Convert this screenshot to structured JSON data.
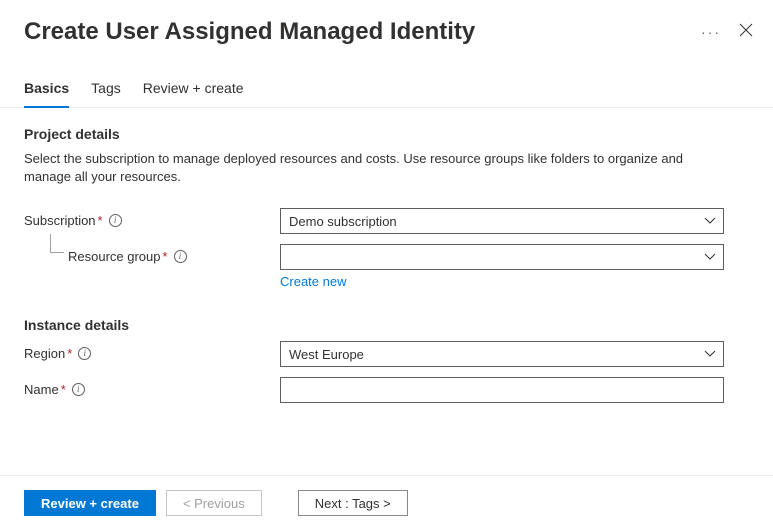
{
  "header": {
    "title": "Create User Assigned Managed Identity"
  },
  "tabs": {
    "basics": "Basics",
    "tags": "Tags",
    "review": "Review + create"
  },
  "sections": {
    "project": {
      "title": "Project details",
      "desc": "Select the subscription to manage deployed resources and costs. Use resource groups like folders to organize and manage all your resources."
    },
    "instance": {
      "title": "Instance details"
    }
  },
  "fields": {
    "subscription": {
      "label": "Subscription",
      "value": "Demo subscription"
    },
    "resource_group": {
      "label": "Resource group",
      "value": "",
      "create_new": "Create new"
    },
    "region": {
      "label": "Region",
      "value": "West Europe"
    },
    "name": {
      "label": "Name",
      "value": ""
    }
  },
  "footer": {
    "review": "Review + create",
    "previous": "< Previous",
    "next": "Next : Tags >"
  }
}
